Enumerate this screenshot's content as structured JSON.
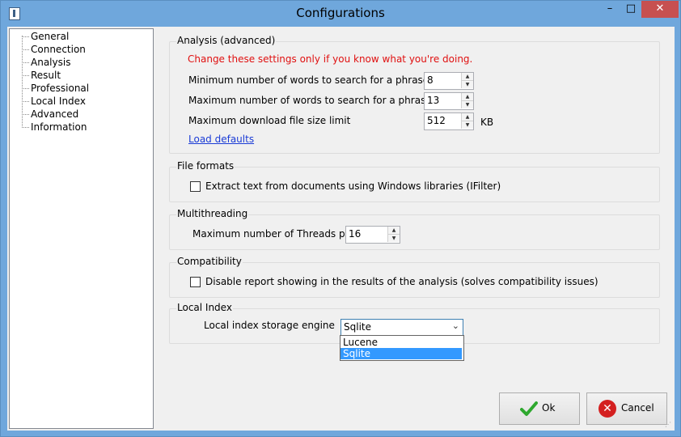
{
  "window": {
    "title": "Configurations",
    "minimize": "–",
    "maximize": "□",
    "close": "✕"
  },
  "tree": {
    "items": [
      "General",
      "Connection",
      "Analysis",
      "Result",
      "Professional",
      "Local Index",
      "Advanced",
      "Information"
    ]
  },
  "analysis": {
    "title": "Analysis (advanced)",
    "warning": "Change these settings only if you know what you're doing.",
    "min_words_label": "Minimum number of words to search for a phrase:",
    "min_words_value": "8",
    "max_words_label": "Maximum number of words to search for a phrase:",
    "max_words_value": "13",
    "max_size_label": "Maximum download file size limit",
    "max_size_value": "512",
    "max_size_unit": "KB",
    "load_defaults": "Load defaults"
  },
  "file_formats": {
    "title": "File formats",
    "checkbox_label": "Extract text from documents using Windows libraries (IFilter)",
    "checked": false
  },
  "multithreading": {
    "title": "Multithreading",
    "threads_label": "Maximum number of Threads per batch d",
    "threads_value": "16"
  },
  "compatibility": {
    "title": "Compatibility",
    "checkbox_label": "Disable report showing in the results of the analysis (solves compatibility issues)",
    "checked": false
  },
  "local_index": {
    "title": "Local Index",
    "engine_label": "Local index storage engine",
    "engine_value": "Sqlite",
    "options": [
      "Lucene",
      "Sqlite"
    ]
  },
  "buttons": {
    "ok": "Ok",
    "cancel": "Cancel"
  },
  "colors": {
    "titlebar": "#6fa7dc",
    "close_button": "#c75050",
    "warning": "#e01010",
    "link": "#1a3bd6",
    "selection": "#3399ff"
  }
}
